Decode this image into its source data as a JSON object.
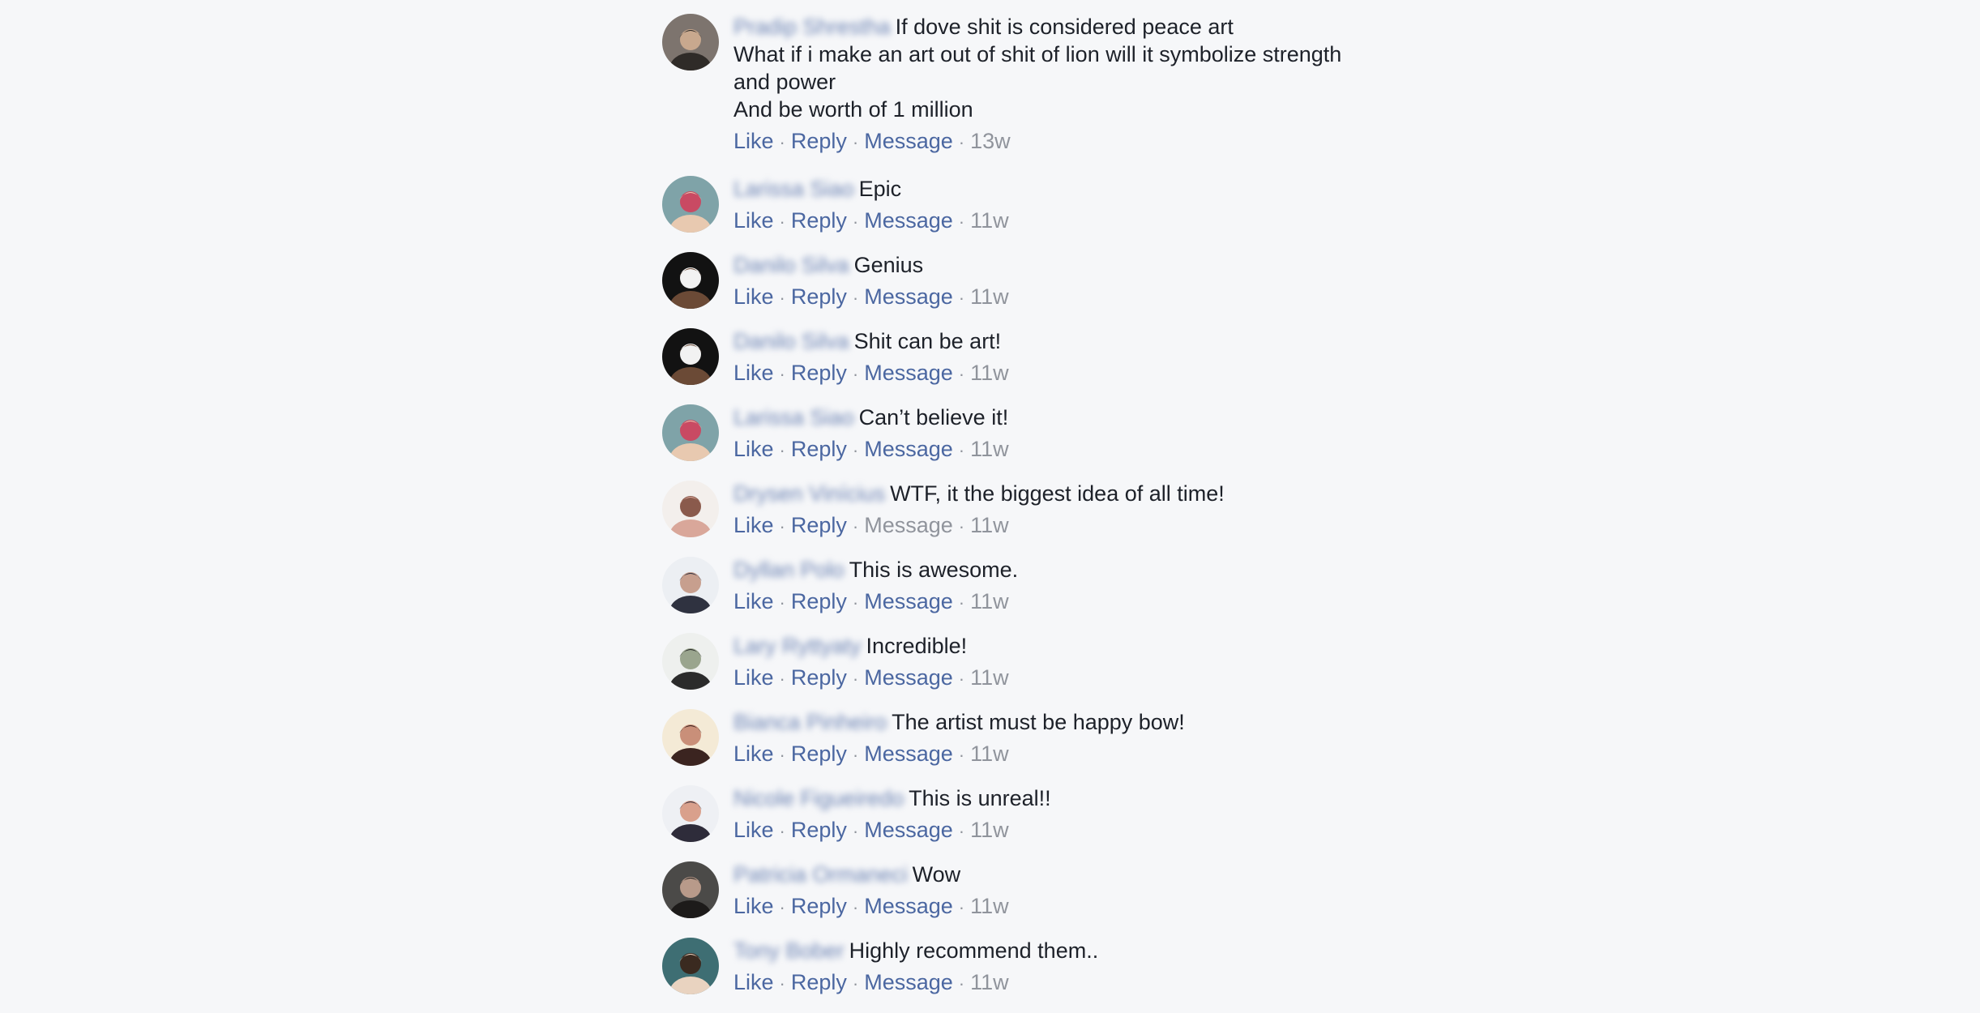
{
  "actions": {
    "like": "Like",
    "reply": "Reply",
    "message": "Message",
    "separator": "·"
  },
  "comments": [
    {
      "author": "Pradip Shrestha",
      "lines": [
        "If dove shit is considered peace art",
        "What if i make an art out of shit of lion will it symbolize strength and power",
        "And be worth of 1 million"
      ],
      "time": "13w",
      "avatar_colors": [
        "#7d746e",
        "#2f2b28",
        "#c8a88e"
      ]
    },
    {
      "author": "Larissa Siao",
      "lines": [
        "Epic"
      ],
      "time": "11w",
      "avatar_colors": [
        "#7fa3a8",
        "#e8c9b0",
        "#c94a63"
      ]
    },
    {
      "author": "Danilo Silva",
      "lines": [
        "Genius"
      ],
      "time": "11w",
      "avatar_colors": [
        "#121212",
        "#6b4a36",
        "#f2f2f2"
      ]
    },
    {
      "author": "Danilo Silva",
      "lines": [
        "Shit can be art!"
      ],
      "time": "11w",
      "avatar_colors": [
        "#121212",
        "#6b4a36",
        "#f2f2f2"
      ]
    },
    {
      "author": "Larissa Siao",
      "lines": [
        "Can’t believe it!"
      ],
      "time": "11w",
      "avatar_colors": [
        "#7fa3a8",
        "#e8c9b0",
        "#c94a63"
      ]
    },
    {
      "author": "Drysen Vinícius",
      "lines": [
        "WTF, it the biggest idea of all time!"
      ],
      "time": "11w",
      "message_disabled": true,
      "avatar_colors": [
        "#f3efec",
        "#d9a79a",
        "#8a5a4c"
      ]
    },
    {
      "author": "Dyllan Polo",
      "lines": [
        "This is awesome."
      ],
      "time": "11w",
      "avatar_colors": [
        "#eceff3",
        "#2f3240",
        "#c79f8e"
      ]
    },
    {
      "author": "Lary Ryttyaty",
      "lines": [
        "Incredible!"
      ],
      "time": "11w",
      "avatar_colors": [
        "#eef0ee",
        "#2b2b2b",
        "#9aa58e"
      ]
    },
    {
      "author": "Bianca Pinheiro",
      "lines": [
        "The artist must be happy bow!"
      ],
      "time": "11w",
      "avatar_colors": [
        "#f4ead6",
        "#3b2420",
        "#c98f79"
      ]
    },
    {
      "author": "Nicole Figueiredo",
      "lines": [
        "This is unreal!!"
      ],
      "time": "11w",
      "avatar_colors": [
        "#eef0f4",
        "#2e2c3a",
        "#d9a08c"
      ]
    },
    {
      "author": "Patricia Ormaneci",
      "lines": [
        "Wow"
      ],
      "time": "11w",
      "avatar_colors": [
        "#4b4a48",
        "#1d1b1a",
        "#b89a8a"
      ]
    },
    {
      "author": "Tony Bober",
      "lines": [
        "Highly recommend them.."
      ],
      "time": "11w",
      "avatar_colors": [
        "#3e6e73",
        "#e9d3c0",
        "#3a2a20"
      ]
    }
  ]
}
